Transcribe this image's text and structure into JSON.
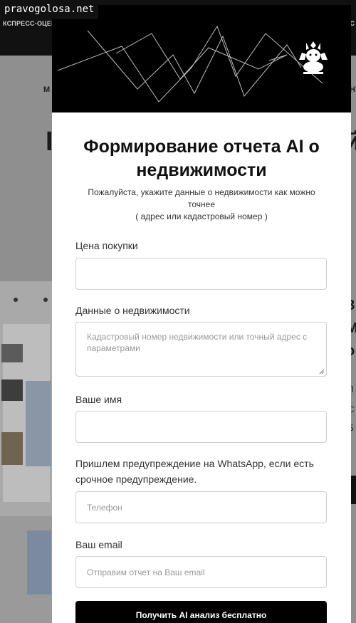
{
  "watermark": "pravogolosa.net",
  "background": {
    "nav_left": "КСПРЕСС-ОЦЕНКА",
    "nav_right": "С",
    "menu_left": "М",
    "menu_right": "Н",
    "big_left": "І",
    "big_right": "й",
    "right_text": [
      "З",
      "М",
      "о"
    ],
    "right_small": [
      "Л",
      "С",
      "Б"
    ]
  },
  "modal": {
    "title": "Формирование отчета AI о недвижимости",
    "subtitle_line1": "Пожалуйста, укажите данные о недвижимости как можно точнее",
    "subtitle_line2": "( адрес или кадастровый номер )",
    "logo_icon": "spider-bull-logo-icon",
    "fields": {
      "price_label": "Цена покупки",
      "price_value": "",
      "property_label": "Данные о недвижимости",
      "property_placeholder": "Кадастровый номер недвижимости или точный адрес с параметрами",
      "name_label": "Ваше имя",
      "name_value": "",
      "whatsapp_label": "Пришлем предупреждение на WhatsApp, если есть срочное предупреждение.",
      "phone_placeholder": "Телефон",
      "email_label": "Ваш email",
      "email_placeholder": "Отправим отчет на Ваш email"
    },
    "submit_label": "Получить AI анализ бесплатно"
  },
  "colors": {
    "overlay": "#8e8e8e",
    "header_bg": "#000000",
    "button_bg": "#000000",
    "field_border": "#cfcfcf"
  }
}
